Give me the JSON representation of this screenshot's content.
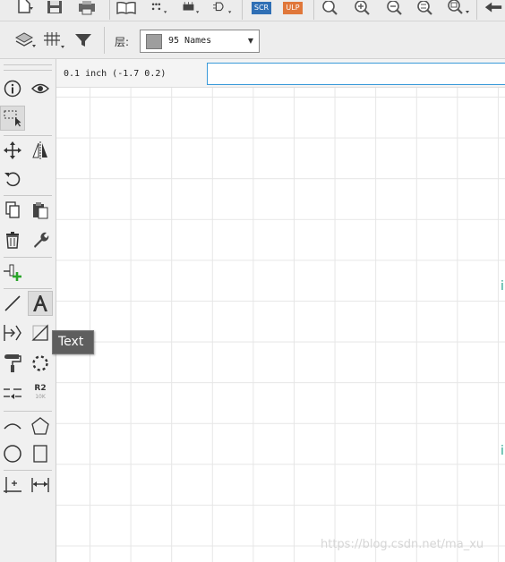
{
  "toolbar": {
    "scr_label": "SCR",
    "ulp_label": "ULP",
    "scr_color": "#2f6fb5",
    "ulp_color": "#e0773a",
    "icons": [
      "new-file-icon",
      "save-icon",
      "print-icon",
      "book-icon",
      "connect-icon",
      "component-icon",
      "gate-icon",
      "zoom-fit-icon",
      "zoom-in-icon",
      "zoom-out-icon",
      "zoom-select-icon",
      "zoom-previous-icon",
      "undo-icon"
    ]
  },
  "layer_bar": {
    "icons": [
      "layer-settings-icon",
      "grid-icon",
      "filter-icon"
    ],
    "label": "层:",
    "selected_layer": "95 Names",
    "swatch_color": "#9e9e9e"
  },
  "coordbar": {
    "coordinates": "0.1 inch (-1.7 0.2)",
    "command_value": "",
    "command_placeholder": ""
  },
  "palette": {
    "tools": [
      "info",
      "eye",
      "group",
      "move",
      "mirror",
      "rotate",
      "copy",
      "paste",
      "delete",
      "change",
      "add",
      "line",
      "text",
      "pin",
      "wire-corner",
      "smash",
      "dashed-circle",
      "split",
      "name-value",
      "arc",
      "polygon",
      "circle",
      "rectangle",
      "attribute",
      "dimension"
    ],
    "name_value_label": "R2",
    "name_value_sub": "10K"
  },
  "tooltip": {
    "text": "Text"
  },
  "canvas": {
    "marks": [
      "i",
      "i"
    ]
  },
  "watermark": {
    "text": "https://blog.csdn.net/ma_xu"
  }
}
